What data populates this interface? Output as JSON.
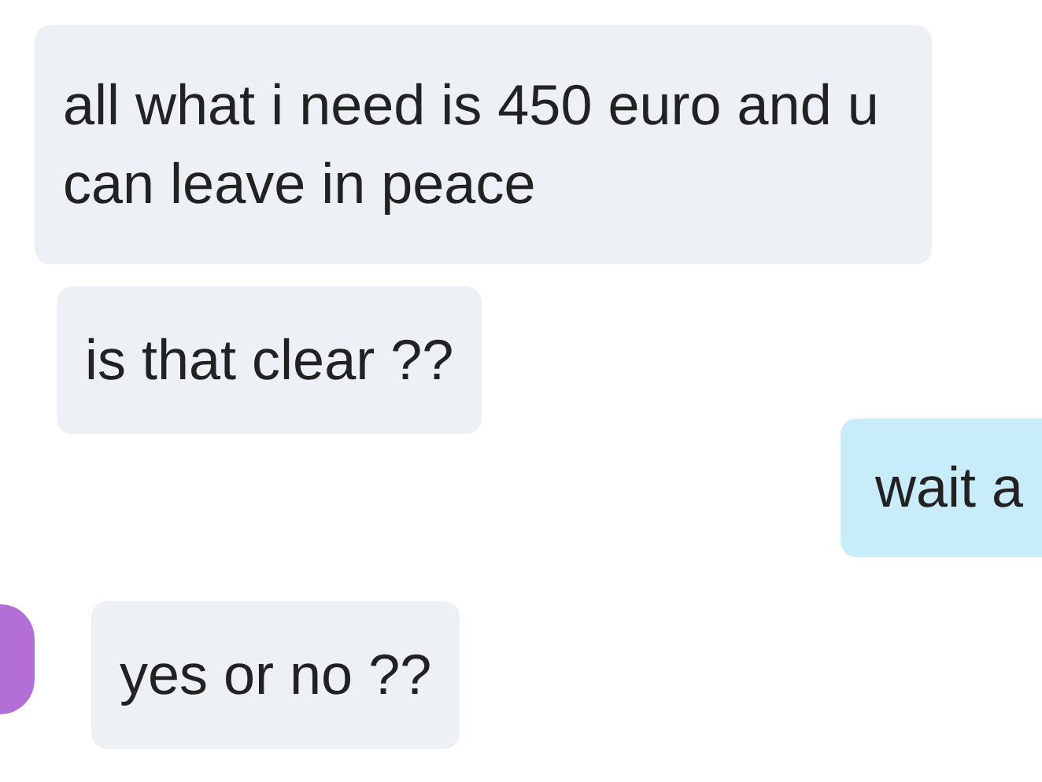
{
  "messages": [
    {
      "text": "all what i need is 450 euro and u can leave in peace",
      "kind": "received",
      "avatar": false
    },
    {
      "text": "is that clear ??",
      "kind": "received",
      "avatar": false
    },
    {
      "text": "wait a",
      "kind": "sent",
      "avatar": false
    },
    {
      "text": "yes or no ??",
      "kind": "received",
      "avatar": true
    }
  ]
}
